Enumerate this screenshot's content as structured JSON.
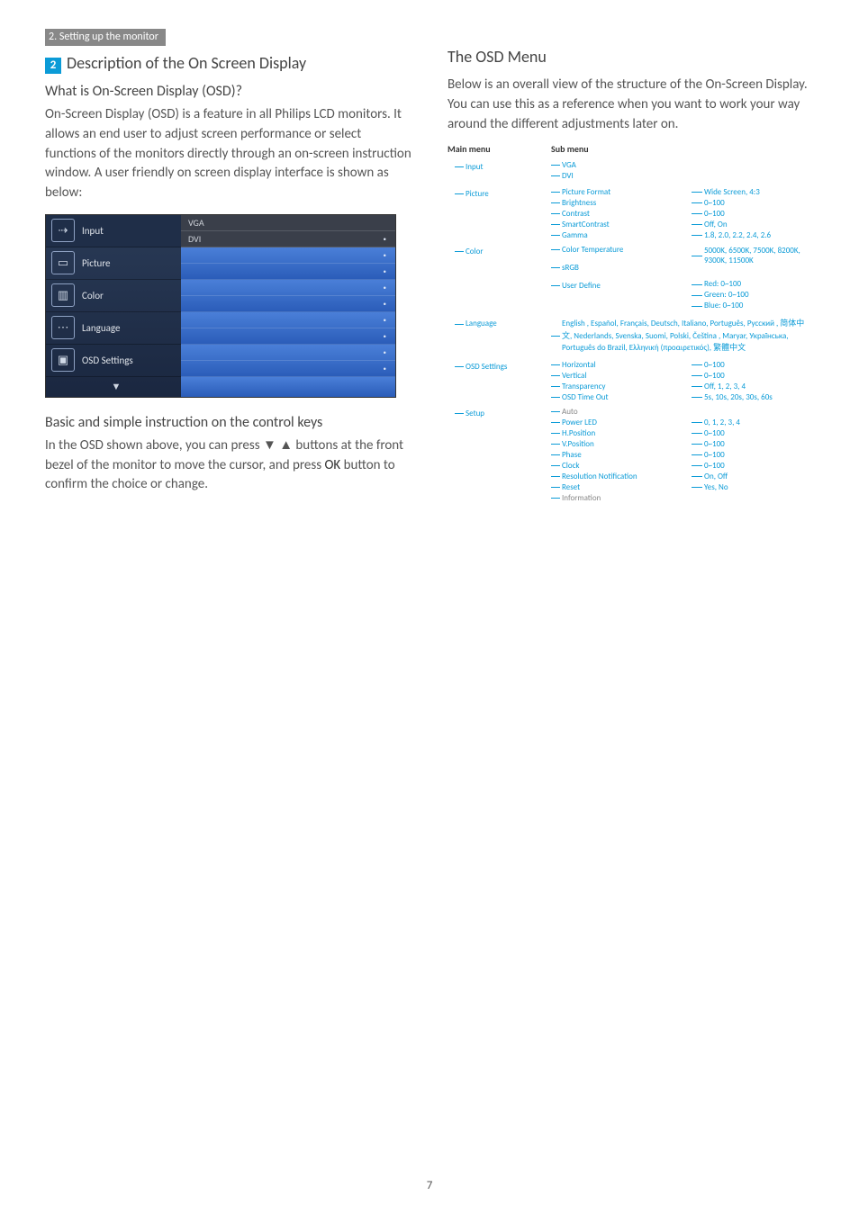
{
  "sectionTag": "2. Setting up the monitor",
  "numBox": "2",
  "title": "Description of the On Screen Display",
  "q1": "What is On-Screen Display (OSD)?",
  "p1": "On-Screen Display (OSD) is a feature in all Philips LCD monitors. It allows an end user to adjust screen performance or select functions of the monitors directly through an on-screen instruction window. A user friendly on screen display interface is shown as below:",
  "q2": "Basic and simple instruction on the control keys",
  "p2a": "In the OSD shown above, you can press ▼ ▲ buttons at the front bezel of the monitor to move the cursor, and press ",
  "p2ok": "OK",
  "p2b": " button to confirm the choice or change.",
  "rightTitle": "The OSD Menu",
  "p3": "Below is an overall view of the structure of the On-Screen Display. You can use this as a reference when you want to work your way around the different adjustments later on.",
  "osd": {
    "rows": [
      {
        "label": "Input",
        "icon": "⇢",
        "r1": "VGA",
        "r2": "DVI"
      },
      {
        "label": "Picture",
        "icon": "▭"
      },
      {
        "label": "Color",
        "icon": "▥"
      },
      {
        "label": "Language",
        "icon": "⋯"
      },
      {
        "label": "OSD Settings",
        "icon": "▣"
      }
    ],
    "arrow": "▼"
  },
  "tree": {
    "h1": "Main menu",
    "h2": "Sub menu",
    "input": {
      "label": "Input",
      "items": [
        "VGA",
        "DVI"
      ]
    },
    "picture": {
      "label": "Picture",
      "items": [
        {
          "n": "Picture Format",
          "v": "Wide Screen, 4:3"
        },
        {
          "n": "Brightness",
          "v": "0~100"
        },
        {
          "n": "Contrast",
          "v": "0~100"
        },
        {
          "n": "SmartContrast",
          "v": "Off, On"
        },
        {
          "n": "Gamma",
          "v": "1.8, 2.0, 2.2, 2.4, 2.6"
        }
      ]
    },
    "color": {
      "label": "Color",
      "ct": {
        "n": "Color Temperature",
        "v": "5000K, 6500K, 7500K, 8200K, 9300K, 11500K"
      },
      "srgb": "sRGB",
      "ud": {
        "n": "User Define",
        "v": [
          "Red: 0~100",
          "Green: 0~100",
          "Blue: 0~100"
        ]
      }
    },
    "language": {
      "label": "Language",
      "text": "English , Español, Français, Deutsch, Italiano, Português, Русский , 简体中文, Nederlands, Svenska, Suomi, Polski, Čeština , Maryar, Українська, Português do Brazil, Ελληνική (προαιρετικός), 繁體中文"
    },
    "osdSettings": {
      "label": "OSD Settings",
      "items": [
        {
          "n": "Horizontal",
          "v": "0~100"
        },
        {
          "n": "Vertical",
          "v": "0~100"
        },
        {
          "n": "Transparency",
          "v": "Off, 1, 2, 3, 4"
        },
        {
          "n": "OSD Time Out",
          "v": "5s, 10s, 20s, 30s, 60s"
        }
      ]
    },
    "setup": {
      "label": "Setup",
      "items": [
        {
          "n": "Auto",
          "v": ""
        },
        {
          "n": "Power LED",
          "v": "0, 1, 2, 3, 4"
        },
        {
          "n": "H.Position",
          "v": "0~100"
        },
        {
          "n": "V.Position",
          "v": "0~100"
        },
        {
          "n": "Phase",
          "v": "0~100"
        },
        {
          "n": "Clock",
          "v": "0~100"
        },
        {
          "n": "Resolution Notification",
          "v": "On, Off"
        },
        {
          "n": "Reset",
          "v": "Yes, No"
        },
        {
          "n": "Information",
          "v": ""
        }
      ]
    }
  },
  "pageNum": "7"
}
